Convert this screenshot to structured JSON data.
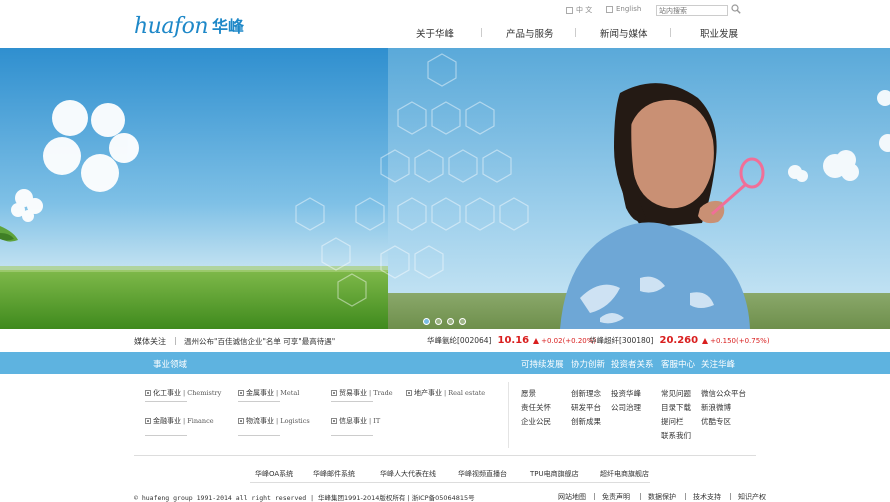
{
  "header": {
    "logo_latin": "huafon",
    "logo_cn": "华峰",
    "lang_cn": "中 文",
    "lang_en": "English",
    "search_placeholder": "站内搜索",
    "nav": [
      "关于华峰",
      "产品与服务",
      "新闻与媒体",
      "职业发展"
    ]
  },
  "news": {
    "label": "媒体关注",
    "separator": "|",
    "headline": "温州公布\"百佳诚信企业\"名单 可享\"最高待遇\""
  },
  "stocks": [
    {
      "name": "华峰氨纶[002064]",
      "price": "10.16",
      "change": "+0.02(+0.20%)"
    },
    {
      "name": "华峰超纤[300180]",
      "price": "20.260",
      "change": "+0.150(+0.75%)"
    }
  ],
  "banner": {
    "slide_count": 4,
    "active_index": 0
  },
  "bluebar": {
    "title": "事业领域",
    "links": [
      "可持续发展",
      "协力创新",
      "投资者关系",
      "客服中心",
      "关注华峰"
    ]
  },
  "business": [
    {
      "cn": "化工事业",
      "en": "Chemistry"
    },
    {
      "cn": "金属事业",
      "en": "Metal"
    },
    {
      "cn": "贸易事业",
      "en": "Trade"
    },
    {
      "cn": "地产事业",
      "en": "Real estate"
    },
    {
      "cn": "金融事业",
      "en": "Finance"
    },
    {
      "cn": "物流事业",
      "en": "Logistics"
    },
    {
      "cn": "信息事业",
      "en": "IT"
    }
  ],
  "columns": [
    [
      "愿景",
      "责任关怀",
      "企业公民"
    ],
    [
      "创新理念",
      "研发平台",
      "创新成果"
    ],
    [
      "投资华峰",
      "公司治理"
    ],
    [
      "常见问题",
      "目录下载",
      "提问栏",
      "联系我们"
    ],
    [
      "微信公众平台",
      "新浪微博",
      "优酷专区"
    ]
  ],
  "footer_links": [
    "华峰OA系统",
    "华峰邮件系统",
    "华峰人大代表在线",
    "华峰视频直播台",
    "TPU电商旗舰店",
    "超纤电商旗舰店"
  ],
  "footer": {
    "copyright_en": "© huafeng group 1991-2014 all right reserved |",
    "copyright_cn": "华峰集团1991-2014版权所有 | 浙ICP备05064815号",
    "links": [
      "网站地图",
      "免责声明",
      "数据保护",
      "技术支持",
      "知识产权"
    ]
  },
  "colors": {
    "brand_blue": "#1e88c8",
    "bar_blue": "#5eb3e0",
    "stock_red": "#d91e1e"
  }
}
